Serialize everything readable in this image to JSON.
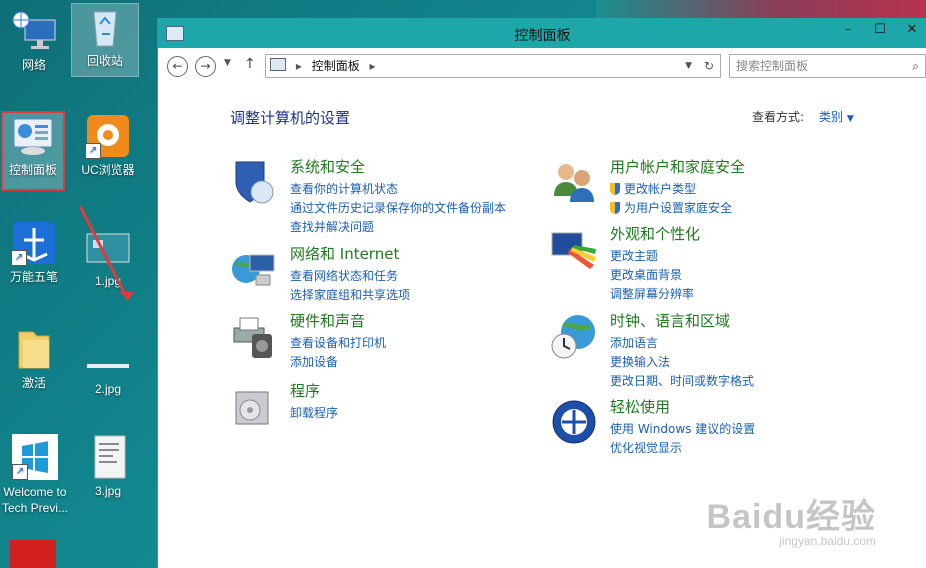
{
  "desktop": {
    "icons": [
      {
        "label": "网络",
        "name": "network-desktop-icon"
      },
      {
        "label": "回收站",
        "name": "recycle-bin-desktop-icon"
      },
      {
        "label": "控制面板",
        "name": "control-panel-desktop-icon"
      },
      {
        "label": "UC浏览器",
        "name": "uc-browser-desktop-icon"
      },
      {
        "label": "万能五笔",
        "name": "wanneng-wubi-desktop-icon"
      },
      {
        "label": "1.jpg",
        "name": "file-1jpg-desktop-icon"
      },
      {
        "label": "激活",
        "name": "jihuo-folder-desktop-icon"
      },
      {
        "label": "2.jpg",
        "name": "file-2jpg-desktop-icon"
      },
      {
        "label": "Welcome to Tech Previ...",
        "name": "welcome-desktop-icon"
      },
      {
        "label": "3.jpg",
        "name": "file-3jpg-desktop-icon"
      }
    ]
  },
  "window": {
    "title": "控制面板",
    "address": "控制面板",
    "search_placeholder": "搜索控制面板",
    "heading": "调整计算机的设置",
    "view_by_label": "查看方式:",
    "view_by_value": "类别",
    "categories_left": [
      {
        "title": "系统和安全",
        "links": [
          "查看你的计算机状态",
          "通过文件历史记录保存你的文件备份副本",
          "查找并解决问题"
        ]
      },
      {
        "title": "网络和 Internet",
        "links": [
          "查看网络状态和任务",
          "选择家庭组和共享选项"
        ]
      },
      {
        "title": "硬件和声音",
        "links": [
          "查看设备和打印机",
          "添加设备"
        ]
      },
      {
        "title": "程序",
        "links": [
          "卸载程序"
        ]
      }
    ],
    "categories_right": [
      {
        "title": "用户帐户和家庭安全",
        "links": [
          "更改帐户类型",
          "为用户设置家庭安全"
        ]
      },
      {
        "title": "外观和个性化",
        "links": [
          "更改主题",
          "更改桌面背景",
          "调整屏幕分辨率"
        ]
      },
      {
        "title": "时钟、语言和区域",
        "links": [
          "添加语言",
          "更换输入法",
          "更改日期、时间或数字格式"
        ]
      },
      {
        "title": "轻松使用",
        "links": [
          "使用 Windows 建议的设置",
          "优化视觉显示"
        ]
      }
    ]
  },
  "watermark": {
    "line1": "Baidu经验",
    "line2": "jingyan.baidu.com"
  },
  "colors": {
    "desktop_bg": "#128890",
    "titlebar": "#1ea7a8",
    "link": "#1a5fb4",
    "category": "#1f7a1f",
    "annotation": "#e03a3a"
  }
}
